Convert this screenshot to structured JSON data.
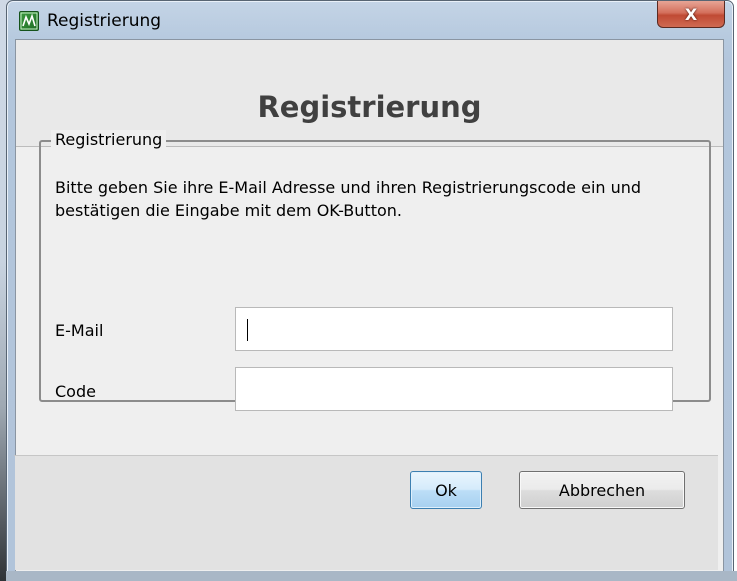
{
  "window": {
    "title": "Registrierung",
    "close_glyph": "X",
    "icon": "app-icon"
  },
  "header": {
    "title": "Registrierung"
  },
  "group": {
    "legend": "Registrierung",
    "description": "Bitte geben Sie ihre E-Mail Adresse und ihren Registrierungscode ein und bestätigen die Eingabe mit dem OK-Button."
  },
  "fields": {
    "email": {
      "label": "E-Mail",
      "value": "",
      "placeholder": ""
    },
    "code": {
      "label": "Code",
      "value": "",
      "placeholder": ""
    }
  },
  "buttons": {
    "ok_label": "Ok",
    "cancel_label": "Abbrechen"
  },
  "colors": {
    "close_red": "#c04a34",
    "ok_blue": "#a7d0f0",
    "title_gray": "#404040"
  }
}
